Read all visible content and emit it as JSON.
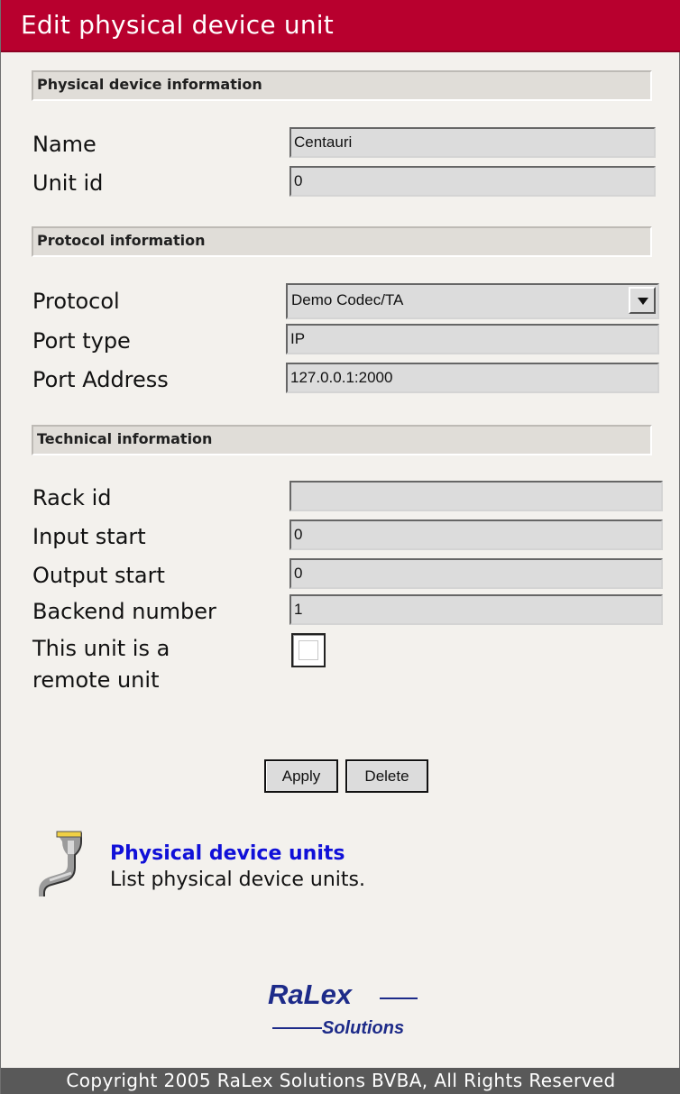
{
  "header": {
    "title": "Edit physical device unit"
  },
  "sections": {
    "physical": "Physical device information",
    "protocol": "Protocol information",
    "technical": "Technical information"
  },
  "fields": {
    "name": {
      "label": "Name",
      "value": "Centauri"
    },
    "unit_id": {
      "label": "Unit id",
      "value": "0"
    },
    "protocol": {
      "label": "Protocol",
      "selected": "Demo Codec/TA"
    },
    "port_type": {
      "label": "Port type",
      "value": "IP"
    },
    "port_address": {
      "label": "Port Address",
      "value": "127.0.0.1:2000"
    },
    "rack_id": {
      "label": "Rack id",
      "value": ""
    },
    "input_start": {
      "label": "Input start",
      "value": "0"
    },
    "output_start": {
      "label": "Output start",
      "value": "0"
    },
    "backend_number": {
      "label": "Backend number",
      "value": "1"
    },
    "remote_unit": {
      "label_line1": "This unit is a",
      "label_line2": "remote unit",
      "checked": false
    }
  },
  "actions": {
    "apply": "Apply",
    "delete": "Delete"
  },
  "nav": {
    "icon": "serial-connector-icon",
    "link": "Physical device units",
    "description": "List physical device units."
  },
  "logo": {
    "line1": "RaLex",
    "line2": "Solutions"
  },
  "footer": {
    "text": "Copyright 2005 RaLex Solutions BVBA, All Rights Reserved"
  },
  "colors": {
    "header": "#b8002e",
    "footer": "#595959",
    "link": "#1010d8",
    "logo": "#1d2b89"
  }
}
